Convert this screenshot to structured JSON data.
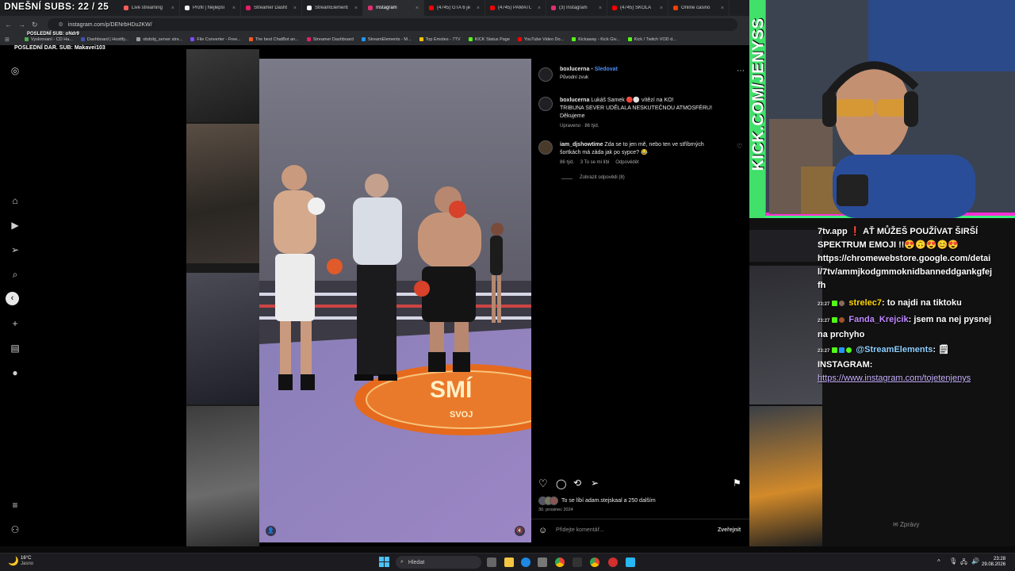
{
  "overlay": {
    "subs_count": "DNEŠNÍ SUBS: 22 / 25",
    "last_sub": "POSLEDNÍ SUB: oNdr9",
    "last_dar": "POSLEDNÍ DAR. SUB: Makavei103"
  },
  "browser": {
    "tabs": [
      {
        "label": "Live streaming",
        "color": "#ff5c5c"
      },
      {
        "label": "Profil | Nejlepší",
        "color": "#f2f2f2"
      },
      {
        "label": "Streamer Dashb",
        "color": "#e91e63"
      },
      {
        "label": "StreamElements",
        "color": "#fafafa"
      },
      {
        "label": "Instagram",
        "color": "#e1306c",
        "active": true
      },
      {
        "label": "(4745) GTA 6 je",
        "color": "#ff0000"
      },
      {
        "label": "(4745) PAMATU",
        "color": "#ff0000"
      },
      {
        "label": "(3) Instagram",
        "color": "#e1306c"
      },
      {
        "label": "(4745) ŠKOLA",
        "color": "#ff0000"
      },
      {
        "label": "Online casino",
        "color": "#ff3d00"
      }
    ],
    "url": "instagram.com/p/DENrbHDu2KW/",
    "bookmarks": [
      {
        "label": "Vyskrovaní - CD Ha...",
        "color": "#4caf50"
      },
      {
        "label": "Dashboard | Hostify...",
        "color": "#3f51b5"
      },
      {
        "label": "obdobj_server stre...",
        "color": "#9e9e9e"
      },
      {
        "label": "File Converter - Free...",
        "color": "#7c4dff"
      },
      {
        "label": "The best ChatBot an...",
        "color": "#ff5722"
      },
      {
        "label": "Streamer Dashboard",
        "color": "#e91e63"
      },
      {
        "label": "StreamElements - M...",
        "color": "#2196f3"
      },
      {
        "label": "Top Emotes - 7TV",
        "color": "#ffc107"
      },
      {
        "label": "KICK Status Page",
        "color": "#53fc18"
      },
      {
        "label": "YouTube Video Do...",
        "color": "#ff0000"
      },
      {
        "label": "Kickaway - Kick Giv...",
        "color": "#53fc18"
      },
      {
        "label": "Kick / Twitch VOD d...",
        "color": "#53fc18"
      }
    ]
  },
  "post": {
    "username": "boxlucerna",
    "follow": "Sledovat",
    "audio": "Původní zvuk",
    "caption_user": "boxlucerna",
    "caption": "Lukáš Samek 🔴⚪ vítězí na KO!",
    "caption_line2": "TRIBUNA SEVER UDĚLALA NESKUTEČNOU ATMOSFÉRU!",
    "caption_line3": "Děkujeme",
    "caption_meta": "Upraveno · 86 týd.",
    "comment_user": "iam_djshowtime",
    "comment_text": "Zda se to jen mě, nebo ten ve stříbrných",
    "comment_text2": "šortkách má záda jak po sypce? 😂",
    "comment_age": "86 týd.",
    "comment_likes": "3 To se mi líbí",
    "comment_reply": "Odpovědět",
    "view_replies": "Zobrazit odpovědi (8)",
    "likes": "To se líbí adam.stejskaal a 250 dalším",
    "date": "30. prosinec 2024",
    "comment_placeholder": "Přidejte komentář...",
    "post_button": "Zveřejnit",
    "ring_text": "SMÍ",
    "ring_text2": "SVOJ"
  },
  "stream": {
    "kick_url": "KICK.COM/JENYSS"
  },
  "chat": {
    "lines": [
      {
        "text": "7tv.app ❗ AŤ MŮŽEŠ POUŽÍVAT ŠIRŠÍ SPEKTRUM EMOJI !!😍🙃😍😊😍",
        "link": "https://chromewebstore.google.com/detail/7tv/ammjkodgmmoknidbanneddgankgfejfh"
      },
      {
        "time": "23:27",
        "user": "strelec7",
        "user_color": "#ffd700",
        "message": ": to najdi na tiktoku"
      },
      {
        "time": "23:27",
        "user": "Fanda_Krejcik",
        "user_color": "#c08aff",
        "message": ": jsem na nej pysnej na prchyho"
      },
      {
        "time": "23:27",
        "user": "@StreamElements",
        "user_color": "#8fd0ff",
        "message": ": 🗒 INSTAGRAM:",
        "link": "https://www.instagram.com/tojetenjenys"
      }
    ],
    "prompt": "Zprávy"
  },
  "taskbar": {
    "weather_temp": "16°C",
    "weather_desc": "Jasno",
    "search": "Hledat",
    "time": "23:28",
    "date": "29.08.2026"
  }
}
